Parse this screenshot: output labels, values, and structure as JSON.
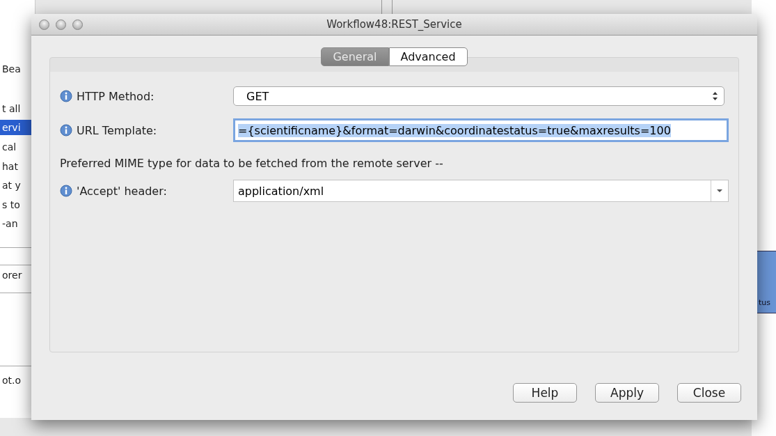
{
  "background_left": {
    "lines": [
      {
        "text": "Bea",
        "selected": false
      },
      {
        "text": "t all",
        "selected": false
      },
      {
        "text": "ervi",
        "selected": true
      },
      {
        "text": "cal",
        "selected": false
      },
      {
        "text": "hat",
        "selected": false
      },
      {
        "text": "at y",
        "selected": false
      },
      {
        "text": "s to",
        "selected": false
      },
      {
        "text": "-an",
        "selected": false
      },
      {
        "text": "orer",
        "selected": false
      },
      {
        "text": "ot.o",
        "selected": false
      }
    ]
  },
  "background_right": {
    "lines": [
      "tus"
    ]
  },
  "window": {
    "title": "Workflow48:REST_Service"
  },
  "tabs": [
    {
      "label": "General",
      "selected": true
    },
    {
      "label": "Advanced",
      "selected": false
    }
  ],
  "rows": [
    {
      "kind": "select",
      "label": "HTTP Method:",
      "value": "GET"
    },
    {
      "kind": "text",
      "label": "URL Template:",
      "value": "={scientificname}&format=darwin&coordinatestatus=true&maxresults=100",
      "selected": true
    },
    {
      "kind": "note",
      "text": "Preferred MIME type for data to be fetched from the remote server --"
    },
    {
      "kind": "combo",
      "label": "'Accept' header:",
      "value": "application/xml"
    }
  ],
  "buttons": [
    "Help",
    "Apply",
    "Close"
  ]
}
